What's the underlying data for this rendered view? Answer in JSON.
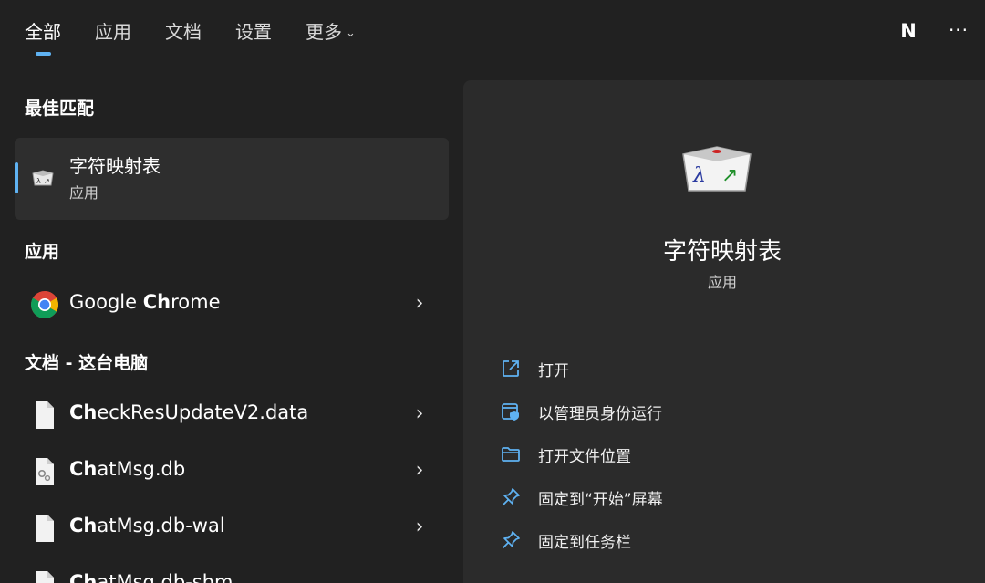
{
  "tabs": [
    {
      "label": "全部",
      "active": true
    },
    {
      "label": "应用",
      "active": false
    },
    {
      "label": "文档",
      "active": false
    },
    {
      "label": "设置",
      "active": false
    },
    {
      "label": "更多",
      "active": false
    }
  ],
  "user": {
    "initial": "N"
  },
  "more_glyph": "···",
  "sections": {
    "best_match": "最佳匹配",
    "apps": "应用",
    "docs": "文档 - 这台电脑"
  },
  "best_match": {
    "name": "字符映射表",
    "type": "应用",
    "icon": "charmap-icon"
  },
  "apps": [
    {
      "prefix": "Google ",
      "bold": "Ch",
      "rest": "rome",
      "icon": "chrome-icon"
    }
  ],
  "docs": [
    {
      "bold": "Ch",
      "rest": "eckResUpdateV2.data",
      "icon": "file-icon"
    },
    {
      "bold": "Ch",
      "rest": "atMsg.db",
      "icon": "db-file-icon"
    },
    {
      "bold": "Ch",
      "rest": "atMsg.db-wal",
      "icon": "file-icon"
    },
    {
      "bold": "Ch",
      "rest": "atMsg.db-shm",
      "icon": "file-icon"
    }
  ],
  "preview": {
    "name": "字符映射表",
    "type": "应用",
    "icon": "charmap-icon"
  },
  "actions": [
    {
      "label": "打开",
      "icon": "open-external-icon"
    },
    {
      "label": "以管理员身份运行",
      "icon": "run-as-admin-icon"
    },
    {
      "label": "打开文件位置",
      "icon": "folder-icon"
    },
    {
      "label": "固定到“开始”屏幕",
      "icon": "pin-icon"
    },
    {
      "label": "固定到任务栏",
      "icon": "pin-icon"
    }
  ],
  "colors": {
    "accent": "#5fb2f2",
    "background": "#212121",
    "panel": "#2b2b2b"
  }
}
